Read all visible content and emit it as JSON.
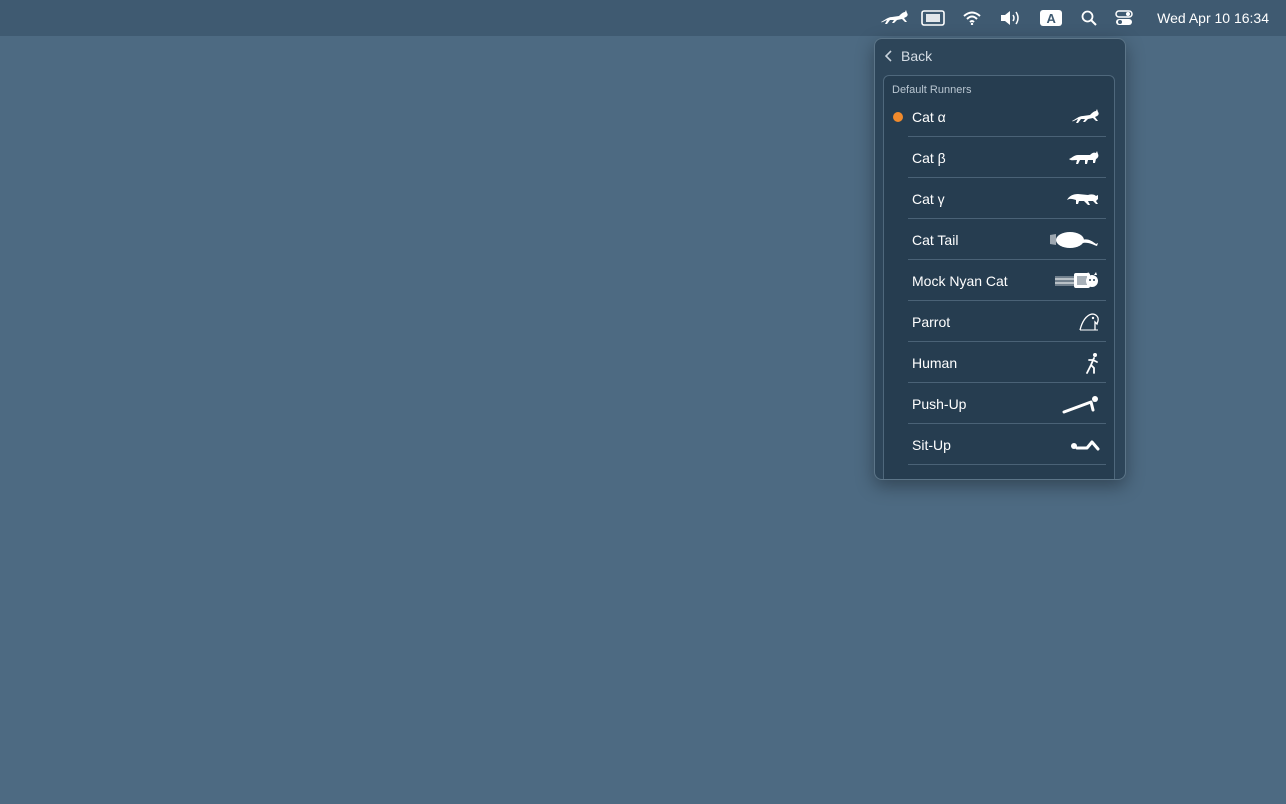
{
  "menubar": {
    "icons": [
      "runcat-icon",
      "screen-mirror-icon",
      "wifi-icon",
      "volume-icon",
      "input-source-icon",
      "search-icon",
      "control-center-icon"
    ],
    "input_source_label": "A",
    "clock": "Wed Apr 10  16:34"
  },
  "popover": {
    "back_label": "Back",
    "section_title": "Default Runners",
    "selected_color": "#f08a2c",
    "runners": [
      {
        "label": "Cat α",
        "icon": "cat-alpha-icon",
        "selected": true
      },
      {
        "label": "Cat β",
        "icon": "cat-beta-icon",
        "selected": false
      },
      {
        "label": "Cat γ",
        "icon": "cat-gamma-icon",
        "selected": false
      },
      {
        "label": "Cat Tail",
        "icon": "cat-tail-icon",
        "selected": false
      },
      {
        "label": "Mock Nyan Cat",
        "icon": "nyan-cat-icon",
        "selected": false
      },
      {
        "label": "Parrot",
        "icon": "parrot-icon",
        "selected": false
      },
      {
        "label": "Human",
        "icon": "human-icon",
        "selected": false
      },
      {
        "label": "Push-Up",
        "icon": "push-up-icon",
        "selected": false
      },
      {
        "label": "Sit-Up",
        "icon": "sit-up-icon",
        "selected": false
      }
    ]
  }
}
